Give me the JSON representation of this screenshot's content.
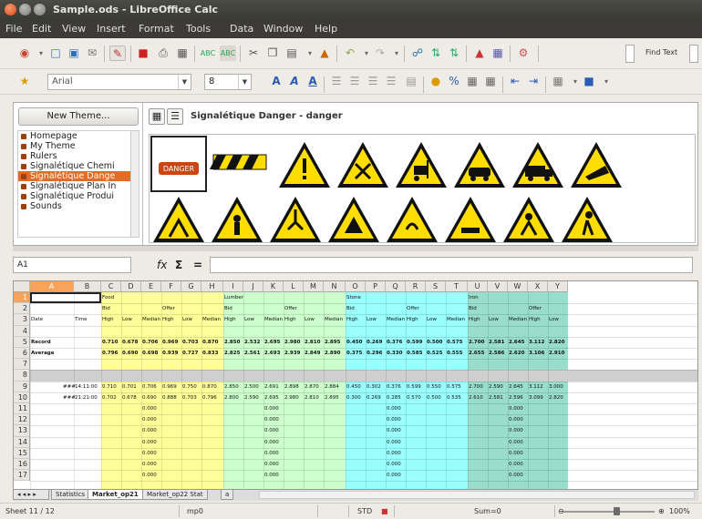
{
  "window": {
    "title": "Sample.ods - LibreOffice Calc"
  },
  "menu": [
    "File",
    "Edit",
    "View",
    "Insert",
    "Format",
    "Tools",
    "Data",
    "Window",
    "Help"
  ],
  "toolbar": {
    "font_name": "Arial",
    "font_size": "8",
    "find_text": "Find Text"
  },
  "gallery": {
    "new_theme_label": "New Theme...",
    "themes": [
      "Homepage",
      "My Theme",
      "Rulers",
      "Signalétique Chemi",
      "Signalétique Dange",
      "Signalétique Plan In",
      "Signalétique Produi",
      "Sounds"
    ],
    "selected_theme": "Signalétique Dange",
    "header_title": "Signalétique Danger - danger",
    "first_sign_text": "DANGER"
  },
  "formula_bar": {
    "cell_ref": "A1",
    "fx_label": "fx",
    "sum_label": "Σ",
    "equals_label": "="
  },
  "sheet": {
    "columns": [
      "A",
      "B",
      "C",
      "D",
      "E",
      "F",
      "G",
      "H",
      "I",
      "J",
      "K",
      "L",
      "M",
      "N",
      "O",
      "P",
      "Q",
      "R",
      "S",
      "T",
      "U",
      "V",
      "W",
      "X",
      "Y"
    ],
    "rows": [
      "1",
      "2",
      "3",
      "4",
      "5",
      "6",
      "7",
      "8",
      "9",
      "10",
      "11",
      "12",
      "13",
      "14",
      "15",
      "16",
      "17"
    ],
    "groups": [
      {
        "name": "Food",
        "color": "#ffff99"
      },
      {
        "name": "Lumber",
        "color": "#ccffcc"
      },
      {
        "name": "Stone",
        "color": "#99ffff"
      },
      {
        "name": "Iron",
        "color": "#99ddcc"
      }
    ],
    "row3_labels": [
      "Date",
      "Time"
    ],
    "sub_headers": [
      "Bid",
      "Offer"
    ],
    "metric_headers": [
      "High",
      "Low",
      "Median"
    ],
    "record_label": "Record",
    "average_label": "Average",
    "row5": [
      "0.710",
      "0.678",
      "0.706",
      "0.969",
      "0.703",
      "0.870",
      "2.850",
      "2.532",
      "2.695",
      "2.980",
      "2.810",
      "2.895",
      "0.450",
      "0.269",
      "0.376",
      "0.599",
      "0.500",
      "0.575",
      "2.700",
      "2.581",
      "2.645",
      "3.112",
      "2.820"
    ],
    "row6": [
      "0.796",
      "0.690",
      "0.698",
      "0.939",
      "0.727",
      "0.833",
      "2.825",
      "2.561",
      "2.693",
      "2.939",
      "2.849",
      "2.890",
      "0.375",
      "0.296",
      "0.330",
      "0.585",
      "0.525",
      "0.555",
      "2.655",
      "2.586",
      "2.620",
      "3.106",
      "2.910"
    ],
    "row9": [
      "###",
      "14:11:00",
      "0.710",
      "0.701",
      "0.706",
      "0.969",
      "0.750",
      "0.870",
      "2.850",
      "2.500",
      "2.691",
      "2.898",
      "2.870",
      "2.884",
      "0.450",
      "0.302",
      "0.376",
      "0.599",
      "0.550",
      "0.575",
      "2.700",
      "2.590",
      "2.645",
      "3.112",
      "3.000"
    ],
    "row10": [
      "###",
      "21:21:00",
      "0.702",
      "0.678",
      "0.690",
      "0.888",
      "0.703",
      "0.796",
      "2.800",
      "2.590",
      "2.695",
      "2.980",
      "2.810",
      "2.895",
      "0.300",
      "0.269",
      "0.285",
      "0.570",
      "0.500",
      "0.535",
      "2.610",
      "2.581",
      "2.596",
      "3.099",
      "2.820"
    ],
    "zero_value": "0.000"
  },
  "tabs": [
    "Statistics",
    "Market_op21",
    "Market_op22 Stat",
    "a"
  ],
  "status": {
    "sheet": "Sheet 11 / 12",
    "style": "mp0",
    "mode": "STD",
    "sum": "Sum=0",
    "zoom": "100%"
  }
}
